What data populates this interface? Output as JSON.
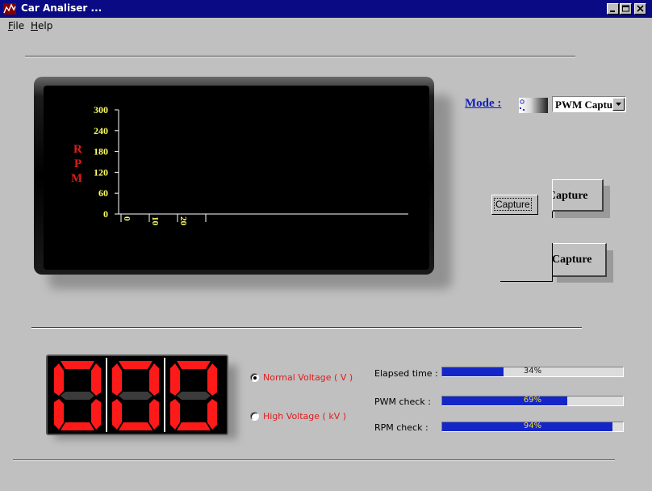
{
  "window": {
    "title": "Car Analiser ...",
    "icon": "chart-zigzag-icon",
    "controls": [
      "minimize-icon",
      "maximize-icon",
      "close-icon"
    ]
  },
  "menu": {
    "file": {
      "accel": "F",
      "rest": "ile"
    },
    "help": {
      "accel": "H",
      "rest": "elp"
    }
  },
  "chart": {
    "ylabel_letters": [
      "R",
      "P",
      "M"
    ],
    "y_ticks": [
      "0",
      "60",
      "120",
      "180",
      "240",
      "300"
    ],
    "x_ticks": [
      "0",
      "10",
      "20"
    ]
  },
  "chart_data": {
    "type": "line",
    "ylabel": "RPM",
    "ylim": [
      0,
      300
    ],
    "y_ticks": [
      0,
      60,
      120,
      180,
      240,
      300
    ],
    "x_ticks": [
      0,
      10,
      20
    ],
    "series": []
  },
  "mode": {
    "label": "Mode :",
    "selected": "PWM Capture",
    "icon": "mode-gradient-icon"
  },
  "buttons": {
    "capture_top": "Capture",
    "capture_bottom": "Capture",
    "capture_ghost": "Capture"
  },
  "display": {
    "digits": [
      "0",
      "0",
      "0"
    ],
    "on_color": "#ff1a1a",
    "off_color": "#3b3b3b"
  },
  "voltage": {
    "normal": {
      "label": "Normal Voltage ( V )",
      "checked": true
    },
    "high": {
      "label": "High Voltage ( kV )",
      "checked": false
    }
  },
  "progress": [
    {
      "label": "Elapsed time :",
      "value": 34,
      "text": "34%"
    },
    {
      "label": "PWM check :",
      "value": 69,
      "text": "69%"
    },
    {
      "label": "RPM check :",
      "value": 94,
      "text": "94%"
    }
  ],
  "colors": {
    "titlebar": "#0a0a84",
    "progress_fill": "#1426c8",
    "axis_label": "#ffff66",
    "rpm_label": "#e01b1b",
    "mode_label": "#1020c0"
  }
}
